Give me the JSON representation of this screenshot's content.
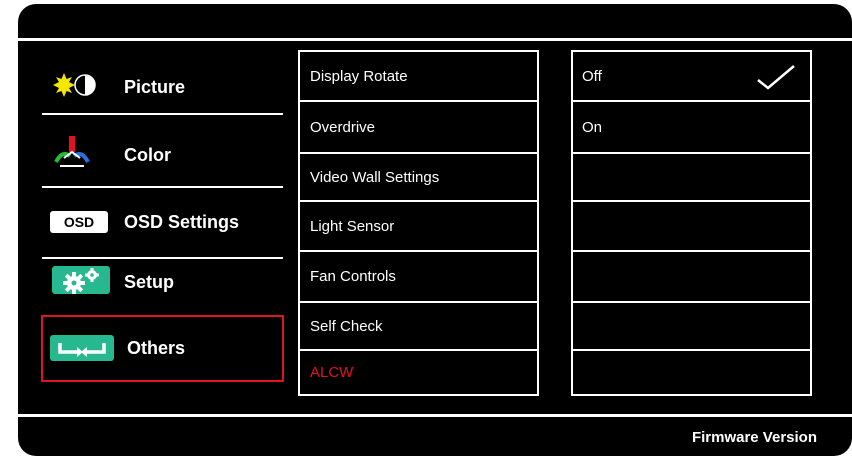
{
  "menu": {
    "items": [
      {
        "label": "Picture",
        "icon": "picture-icon"
      },
      {
        "label": "Color",
        "icon": "color-icon"
      },
      {
        "label": "OSD Settings",
        "icon": "osd-icon",
        "icon_text": "OSD"
      },
      {
        "label": "Setup",
        "icon": "setup-gears-icon"
      },
      {
        "label": "Others",
        "icon": "others-icon",
        "selected": true
      }
    ]
  },
  "submenu": {
    "items": [
      {
        "label": "Display Rotate"
      },
      {
        "label": "Overdrive"
      },
      {
        "label": "Video Wall Settings"
      },
      {
        "label": "Light Sensor"
      },
      {
        "label": "Fan Controls"
      },
      {
        "label": "Self Check"
      },
      {
        "label": "ALCW",
        "highlight": "red"
      }
    ]
  },
  "options": {
    "items": [
      {
        "label": "Off",
        "checked": true
      },
      {
        "label": "On"
      },
      {
        "label": ""
      },
      {
        "label": ""
      },
      {
        "label": ""
      },
      {
        "label": ""
      },
      {
        "label": ""
      }
    ]
  },
  "footer": {
    "firmware": "Firmware Version"
  },
  "colors": {
    "background": "#000000",
    "selected_border": "#e0141e",
    "teal": "#27b88f",
    "text_red": "#e0141e"
  }
}
